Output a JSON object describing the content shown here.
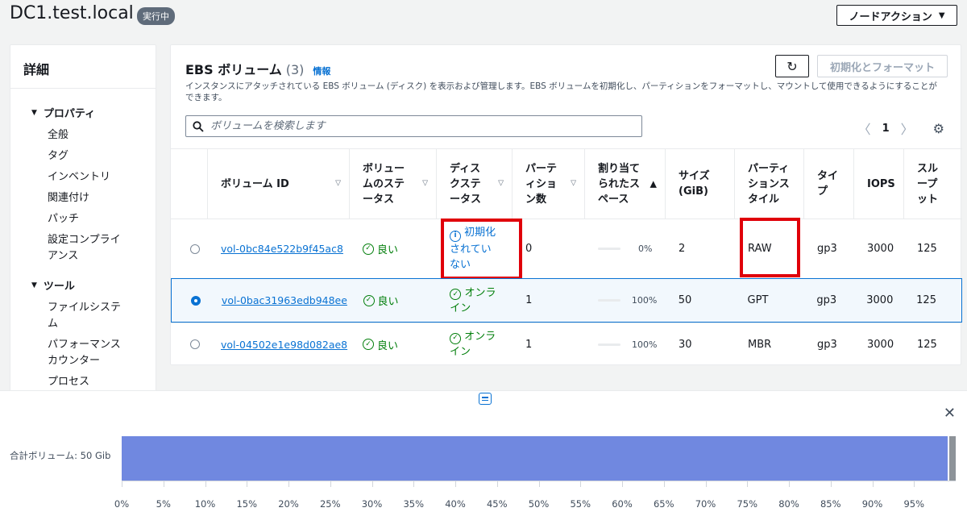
{
  "header": {
    "title": "DC1.test.local",
    "status_badge": "実行中",
    "node_action_label": "ノードアクション"
  },
  "sidebar": {
    "title": "詳細",
    "sections": [
      {
        "title": "プロパティ",
        "items": [
          "全般",
          "タグ",
          "インベントリ",
          "関連付け",
          "パッチ",
          "設定コンプライアンス"
        ]
      },
      {
        "title": "ツール",
        "items": [
          "ファイルシステム",
          "パフォーマンスカウンター",
          "プロセス"
        ]
      }
    ]
  },
  "panel": {
    "title": "EBS ボリューム",
    "count": "(3)",
    "info_link": "情報",
    "refresh_icon": "refresh-icon",
    "init_button": "初期化とフォーマット",
    "description": "インスタンスにアタッチされている EBS ボリューム (ディスク) を表示および管理します。EBS ボリュームを初期化し、パーティションをフォーマットし、マウントして使用できるようにすることができます。",
    "search_placeholder": "ボリュームを検索します",
    "page_number": "1"
  },
  "table": {
    "columns": [
      "ボリューム ID",
      "ボリュームのステータス",
      "ディスクステータス",
      "パーティション数",
      "割り当てられたスペース",
      "サイズ (GiB)",
      "パーティションスタイル",
      "タイプ",
      "IOPS",
      "スループット"
    ],
    "rows": [
      {
        "selected": false,
        "volume_id": "vol-0bc84e522b9f45ac8",
        "volume_status": "良い",
        "disk_status": "初期化されていない",
        "disk_status_kind": "info",
        "partitions": "0",
        "allocated_pct": 0,
        "allocated_label": "0%",
        "size": "2",
        "style": "RAW",
        "type": "gp3",
        "iops": "3000",
        "throughput": "125"
      },
      {
        "selected": true,
        "volume_id": "vol-0bac31963edb948ee",
        "volume_status": "良い",
        "disk_status": "オンライン",
        "disk_status_kind": "ok",
        "partitions": "1",
        "allocated_pct": 100,
        "allocated_label": "100%",
        "size": "50",
        "style": "GPT",
        "type": "gp3",
        "iops": "3000",
        "throughput": "125"
      },
      {
        "selected": false,
        "volume_id": "vol-04502e1e98d082ae8",
        "volume_status": "良い",
        "disk_status": "オンライン",
        "disk_status_kind": "ok",
        "partitions": "1",
        "allocated_pct": 100,
        "allocated_label": "100%",
        "size": "30",
        "style": "MBR",
        "type": "gp3",
        "iops": "3000",
        "throughput": "125"
      }
    ]
  },
  "bottom": {
    "total_label": "合計ボリューム: 50 Gib",
    "bar_fraction": 0.99,
    "ticks": [
      "0%",
      "5%",
      "10%",
      "15%",
      "20%",
      "25%",
      "30%",
      "35%",
      "40%",
      "45%",
      "50%",
      "55%",
      "60%",
      "65%",
      "70%",
      "75%",
      "80%",
      "85%",
      "90%",
      "95%"
    ],
    "bar_color": "#7088e0"
  },
  "colors": {
    "link": "#0972d3",
    "success": "#037f0c",
    "highlight": "#e0000a"
  }
}
